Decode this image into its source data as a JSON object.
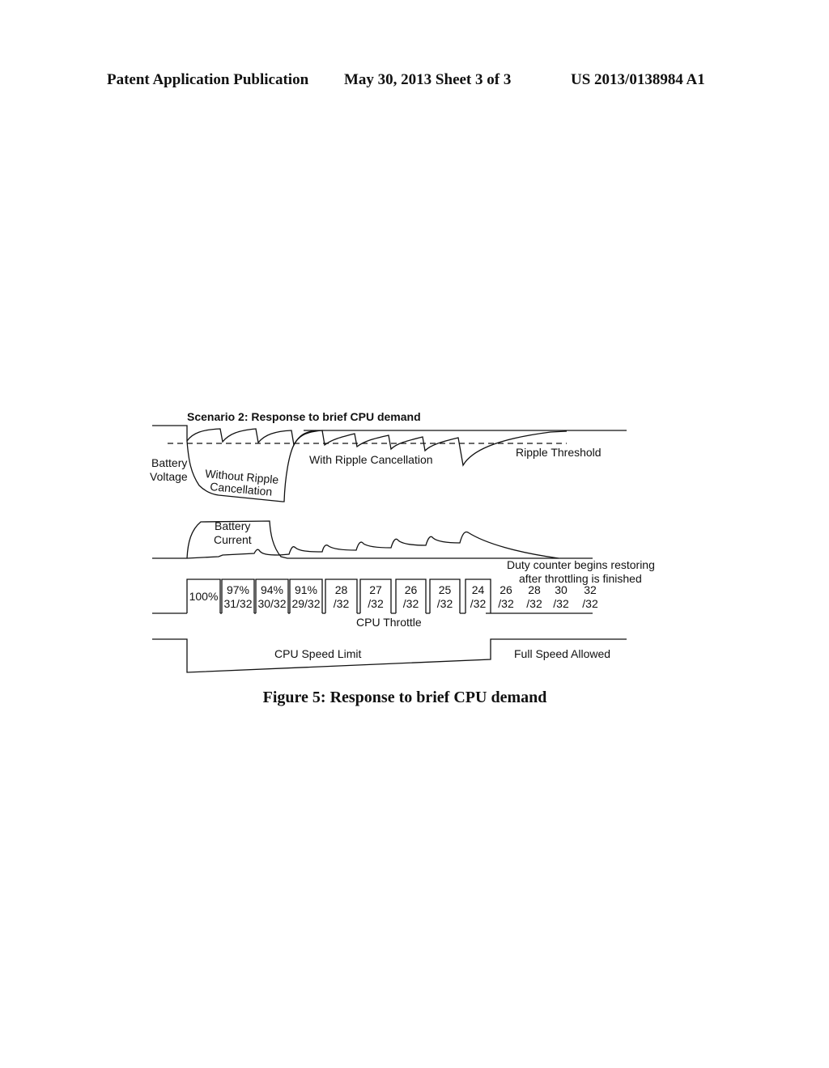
{
  "header": {
    "publication": "Patent Application Publication",
    "date_sheet": "May 30, 2013  Sheet 3 of 3",
    "number": "US 2013/0138984 A1"
  },
  "figure": {
    "title": "Scenario 2:  Response to brief CPU demand",
    "caption": "Figure 5:  Response to brief CPU demand",
    "labels": {
      "battery_voltage_line1": "Battery",
      "battery_voltage_line2": "Voltage",
      "without_ripple_line1": "Without Ripple",
      "without_ripple_line2": "Cancellation",
      "with_ripple": "With Ripple Cancellation",
      "ripple_threshold": "Ripple Threshold",
      "battery_current_line1": "Battery",
      "battery_current_line2": "Current",
      "duty_counter_line1": "Duty counter begins restoring",
      "duty_counter_line2": "after throttling is finished",
      "cpu_throttle": "CPU Throttle",
      "cpu_speed_limit": "CPU Speed Limit",
      "full_speed_allowed": "Full Speed Allowed"
    },
    "throttle_steps": [
      {
        "top": "",
        "bottom": "100%",
        "boxed": true
      },
      {
        "top": "97%",
        "bottom": "31/32",
        "boxed": true
      },
      {
        "top": "94%",
        "bottom": "30/32",
        "boxed": true
      },
      {
        "top": "91%",
        "bottom": "29/32",
        "boxed": true
      },
      {
        "top": "28",
        "bottom": "/32",
        "boxed": true
      },
      {
        "top": "27",
        "bottom": "/32",
        "boxed": true
      },
      {
        "top": "26",
        "bottom": "/32",
        "boxed": true
      },
      {
        "top": "25",
        "bottom": "/32",
        "boxed": true
      },
      {
        "top": "24",
        "bottom": "/32",
        "boxed": true
      },
      {
        "top": "26",
        "bottom": "/32",
        "boxed": false
      },
      {
        "top": "28",
        "bottom": "/32",
        "boxed": false
      },
      {
        "top": "30",
        "bottom": "/32",
        "boxed": false
      },
      {
        "top": "32",
        "bottom": "/32",
        "boxed": false
      }
    ]
  }
}
